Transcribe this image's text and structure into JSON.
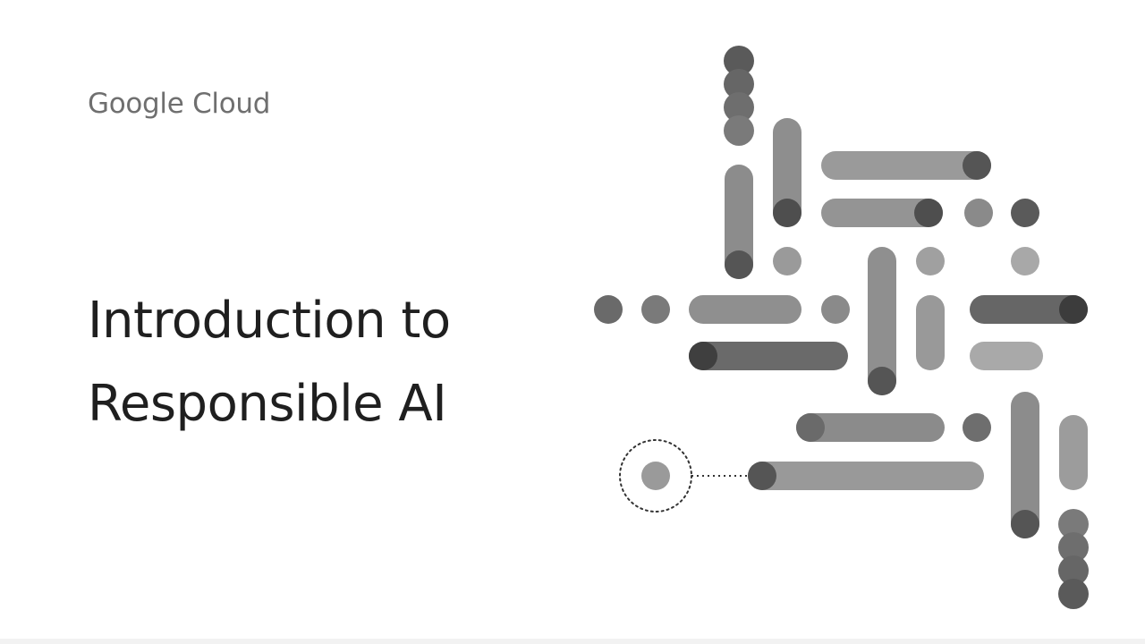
{
  "brand": {
    "logo_text": "Google Cloud"
  },
  "title": {
    "line1": "Introduction to",
    "line2": "Responsible AI"
  },
  "illustration": {
    "icon": "abstract-pill-network",
    "colors": {
      "light": "#9b9b9b",
      "mid": "#8a8a8a",
      "dark": "#505050",
      "darker": "#3e3e3e"
    }
  }
}
